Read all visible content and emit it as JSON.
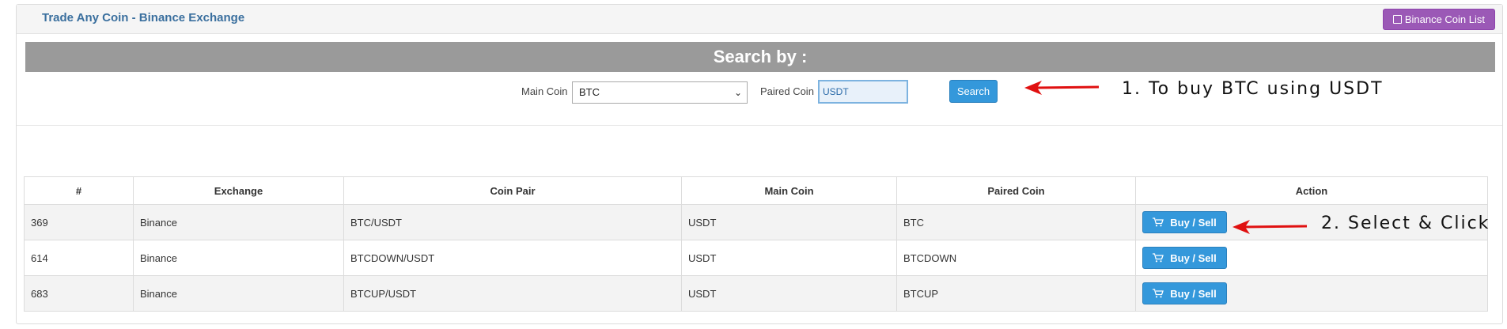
{
  "panel": {
    "title": "Trade Any Coin - Binance Exchange",
    "coin_list_button": "Binance Coin List"
  },
  "search": {
    "heading": "Search by :",
    "main_coin_label": "Main Coin",
    "main_coin_value": "BTC",
    "paired_coin_label": "Paired Coin",
    "paired_coin_value": "USDT",
    "button": "Search"
  },
  "annotations": {
    "step1": "1.  To buy BTC using USDT",
    "step2": "2. Select & Click",
    "arrow_color": "#e01010"
  },
  "table": {
    "headers": [
      "#",
      "Exchange",
      "Coin Pair",
      "Main Coin",
      "Paired Coin",
      "Action"
    ],
    "rows": [
      {
        "id": "369",
        "exchange": "Binance",
        "pair": "BTC/USDT",
        "main": "USDT",
        "paired": "BTC",
        "action": "Buy / Sell"
      },
      {
        "id": "614",
        "exchange": "Binance",
        "pair": "BTCDOWN/USDT",
        "main": "USDT",
        "paired": "BTCDOWN",
        "action": "Buy / Sell"
      },
      {
        "id": "683",
        "exchange": "Binance",
        "pair": "BTCUP/USDT",
        "main": "USDT",
        "paired": "BTCUP",
        "action": "Buy / Sell"
      }
    ]
  },
  "colors": {
    "accent_blue": "#3498db",
    "purple_button": "#9b59b6",
    "search_bar": "#9a9a9a"
  }
}
